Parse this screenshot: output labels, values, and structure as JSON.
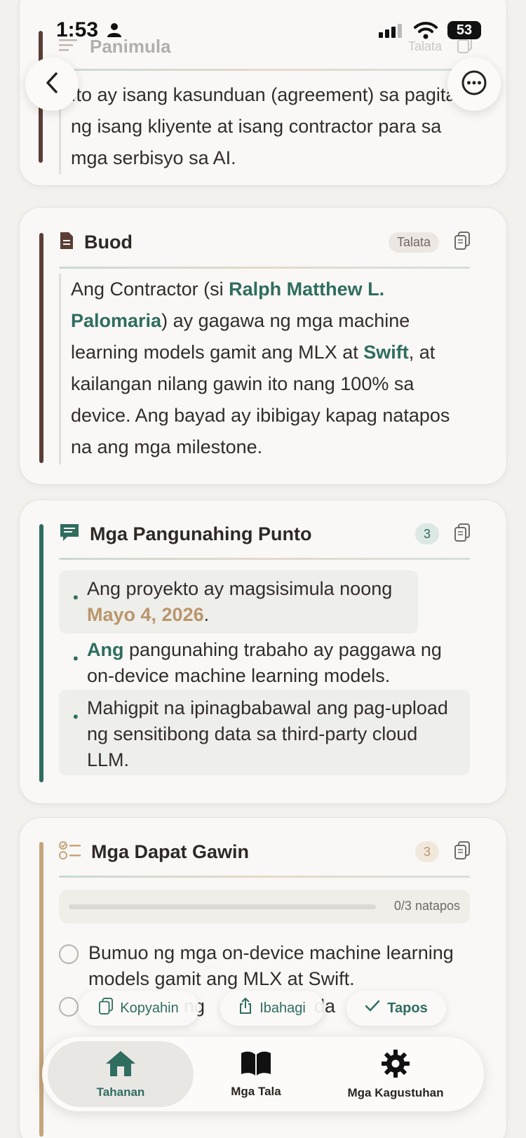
{
  "status_bar": {
    "time": "1:53",
    "battery": "53"
  },
  "nav": {
    "back_icon": "chevron-left-icon",
    "more_icon": "ellipsis-circle-icon"
  },
  "intro_card": {
    "title": "Panimula",
    "badge": "Talata",
    "text": "Ito ay isang kasunduan (agreement) sa pagitan ng isang kliyente at isang contractor para sa mga serbisyo sa AI."
  },
  "summary_card": {
    "title": "Buod",
    "badge": "Talata",
    "text_1": "Ang Contractor (si ",
    "name": "Ralph Matthew L. Palomaria",
    "text_2": ") ay gagawa ng mga machine learning models gamit ang MLX at ",
    "swift": "Swift",
    "text_3": ", at kailangan nilang gawin ito nang 100% sa device. Ang bayad ay ibibigay kapag natapos na ang mga milestone."
  },
  "points_card": {
    "title": "Mga Pangunahing Punto",
    "count": "3",
    "p1_text": "Ang proyekto ay magsisimula noong ",
    "p1_date": "Mayo 4, 2026",
    "p1_end": ".",
    "p2_hl": "Ang",
    "p2_text": " pangunahing trabaho ay paggawa ng on-device machine learning models.",
    "p3_text": "Mahigpit na ipinagbabawal ang pag-upload ng sensitibong data sa third-party cloud LLM."
  },
  "todo_card": {
    "title": "Mga Dapat Gawin",
    "count": "3",
    "progress_label": "0/3 natapos",
    "progress_fraction": 0,
    "item_1": "Bumuo ng mga on-device machine learning models gamit ang MLX at Swift.",
    "item_2": "ng",
    "item_2_end": "da"
  },
  "actions": {
    "copy": "Kopyahin",
    "share": "Ibahagi",
    "done": "Tapos"
  },
  "tabs": [
    {
      "label": "Tahanan",
      "icon": "house-icon"
    },
    {
      "label": "Mga Tala",
      "icon": "book-icon"
    },
    {
      "label": "Mga Kagustuhan",
      "icon": "gear-icon"
    }
  ],
  "colors": {
    "brand_green": "#2f6d5f",
    "tan": "#b9966b",
    "brown": "#5a3e36"
  }
}
